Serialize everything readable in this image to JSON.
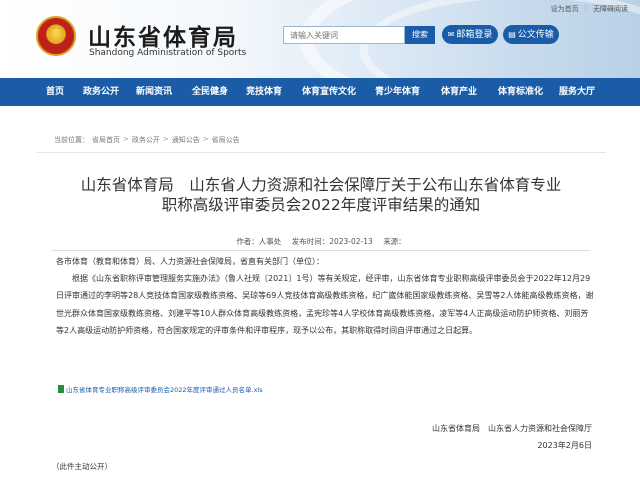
{
  "top_links": {
    "set_home": "设为首页",
    "accessible": "无障碍阅读"
  },
  "site": {
    "title": "山东省体育局",
    "subtitle": "Shandong Administration of Sports"
  },
  "search": {
    "placeholder": "请输入关键词",
    "button": "搜索"
  },
  "header_buttons": {
    "mail": "邮箱登录",
    "doc": "公文传输"
  },
  "nav": [
    "首页",
    "政务公开",
    "新闻资讯",
    "全民健身",
    "竞技体育",
    "体育宣传文化",
    "青少年体育",
    "体育产业",
    "体育标准化",
    "服务大厅"
  ],
  "breadcrumb": [
    "当前位置：",
    "省局首页",
    "政务公开",
    "通知公告",
    "省局公告"
  ],
  "article": {
    "title_line1": "山东省体育局　山东省人力资源和社会保障厅关于公布山东省体育专业",
    "title_line2": "职称高级评审委员会2022年度评审结果的通知",
    "meta": {
      "author": "作者：人事处",
      "date": "发布时间：2023-02-13",
      "source": "来源："
    },
    "salutation": "各市体育（教育和体育）局、人力资源社会保障局，省直有关部门（单位）：",
    "paragraph": "根据《山东省职称评审管理服务实施办法》（鲁人社规〔2021〕1号）等有关规定，经评审，山东省体育专业职称高级评审委员会于2022年12月29日评审通过的李明等28人竞技体育国家级教练资格、吴琼等69人竞技体育高级教练资格，纪广崴体能国家级教练资格、吴雪等2人体能高级教练资格，谢世光群众体育国家级教练资格、刘建平等10人群众体育高级教练资格，孟宪珍等4人学校体育高级教练资格，凌军等4人正高级运动防护师资格、刘丽芳等2人高级运动防护师资格，符合国家规定的评审条件和评审程序，现予以公布，其职称取得时间自评审通过之日起算。",
    "attachment": "山东省体育专业职称高级评审委员会2022年度评审通过人员名单.xls",
    "signature": "山东省体育局　山东省人力资源和社会保障厅",
    "sign_date": "2023年2月6日",
    "public_note": "（此件主动公开）"
  }
}
